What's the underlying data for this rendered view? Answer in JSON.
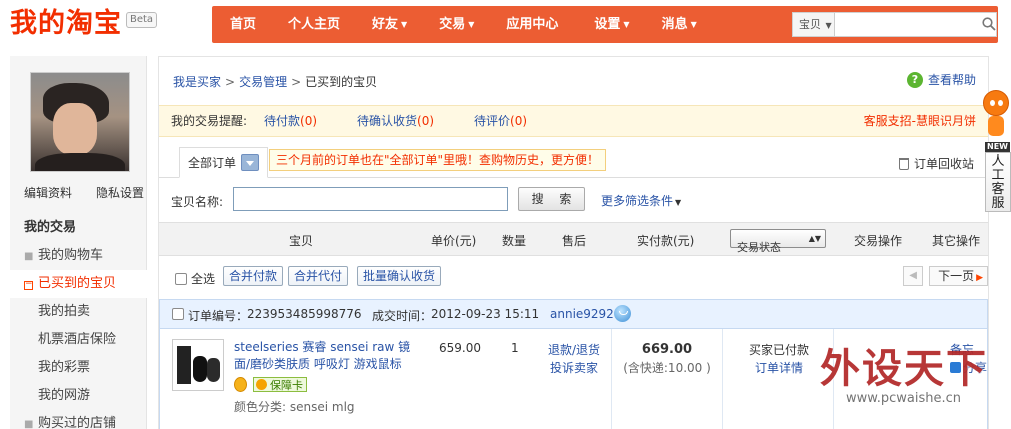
{
  "header": {
    "logo": "我的淘宝",
    "beta": "Beta",
    "nav": [
      {
        "label": "首页",
        "dropdown": false
      },
      {
        "label": "个人主页",
        "dropdown": false
      },
      {
        "label": "好友",
        "dropdown": true
      },
      {
        "label": "交易",
        "dropdown": true
      },
      {
        "label": "应用中心",
        "dropdown": false
      },
      {
        "label": "设置",
        "dropdown": true
      },
      {
        "label": "消息",
        "dropdown": true
      }
    ],
    "search_scope": "宝贝",
    "search_value": ""
  },
  "sidebar": {
    "edit_profile": "编辑资料",
    "privacy": "隐私设置",
    "section_title": "我的交易",
    "items": [
      {
        "label": "我的购物车"
      },
      {
        "label": "已买到的宝贝"
      },
      {
        "label": "我的拍卖"
      },
      {
        "label": "机票酒店保险"
      },
      {
        "label": "我的彩票"
      },
      {
        "label": "我的网游"
      },
      {
        "label": "购买过的店铺"
      }
    ]
  },
  "breadcrumb": [
    "我是买家",
    "交易管理",
    "已买到的宝贝"
  ],
  "help": "查看帮助",
  "reminder": {
    "label": "我的交易提醒:",
    "pay": "待付款",
    "pay_count": "(0)",
    "confirm": "待确认收货",
    "confirm_count": "(0)",
    "rate": "待评价",
    "rate_count": "(0)",
    "right_link": "客服支招-慧眼识月饼"
  },
  "tabs": {
    "all_orders": "全部订单",
    "tip": "三个月前的订单也在\"全部订单\"里哦！查购物历史，更方便！",
    "recycle": "订单回收站"
  },
  "search": {
    "label": "宝贝名称:",
    "value": "",
    "button": "搜 索",
    "more": "更多筛选条件"
  },
  "table_head": {
    "item": "宝贝",
    "unit_price": "单价(元)",
    "quantity": "数量",
    "after_sale": "售后",
    "paid": "实付款(元)",
    "status_select": "交易状态",
    "action": "交易操作",
    "other": "其它操作"
  },
  "bulk": {
    "select_all": "全选",
    "merge_pay": "合并付款",
    "merge_proxy": "合并代付",
    "batch_confirm": "批量确认收货",
    "next_page": "下一页"
  },
  "order": {
    "number_label": "订单编号：",
    "number": "223953485998776",
    "time_label": "成交时间：",
    "time": "2012-09-23 15:11",
    "seller": "annie9292",
    "product_name": "steelseries 赛睿 sensei raw 镜面/磨砂类肤质 呼吸灯 游戏鼠标",
    "badge": "保障卡",
    "color_category": "颜色分类: sensei mlg",
    "price": "659.00",
    "quantity": "1",
    "refund": "退款/退货",
    "complain": "投诉卖家",
    "paid_total": "669.00",
    "shipping": "(含快递:10.00 )",
    "status": "买家已付款",
    "detail": "订单详情",
    "memo": "备忘",
    "share": "分享"
  },
  "customer_service": {
    "new": "NEW",
    "label": "人工客服"
  },
  "watermark": {
    "big": "外设天下",
    "small": "www.pcwaishe.cn"
  }
}
